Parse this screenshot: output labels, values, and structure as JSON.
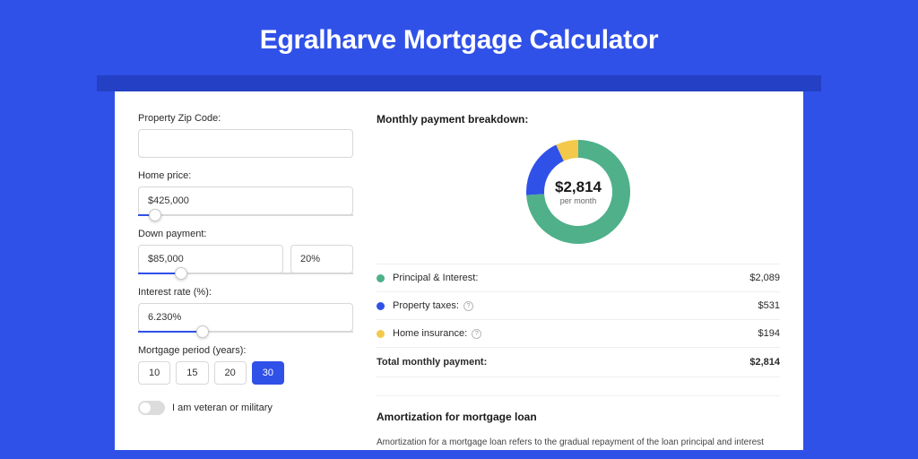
{
  "header": {
    "title": "Egralharve Mortgage Calculator"
  },
  "form": {
    "zip_label": "Property Zip Code:",
    "zip_value": "",
    "home_price_label": "Home price:",
    "home_price_value": "$425,000",
    "home_price_slider_pct": 8,
    "down_payment_label": "Down payment:",
    "down_payment_value": "$85,000",
    "down_payment_pct_value": "20%",
    "down_payment_slider_pct": 20,
    "interest_label": "Interest rate (%):",
    "interest_value": "6.230%",
    "interest_slider_pct": 30,
    "period_label": "Mortgage period (years):",
    "period_options": [
      "10",
      "15",
      "20",
      "30"
    ],
    "period_selected": "30",
    "veteran_label": "I am veteran or military",
    "veteran_checked": false
  },
  "breakdown": {
    "title": "Monthly payment breakdown:",
    "center_amount": "$2,814",
    "center_sub": "per month",
    "items": [
      {
        "label": "Principal & Interest:",
        "value": "$2,089",
        "color": "#4fb08a",
        "pct": 74,
        "help": false
      },
      {
        "label": "Property taxes:",
        "value": "$531",
        "color": "#3051e8",
        "pct": 19,
        "help": true
      },
      {
        "label": "Home insurance:",
        "value": "$194",
        "color": "#f3c94b",
        "pct": 7,
        "help": true
      }
    ],
    "total_label": "Total monthly payment:",
    "total_value": "$2,814"
  },
  "amortization": {
    "title": "Amortization for mortgage loan",
    "text": "Amortization for a mortgage loan refers to the gradual repayment of the loan principal and interest over a specified"
  },
  "chart_data": {
    "type": "pie",
    "title": "Monthly payment breakdown",
    "series": [
      {
        "name": "Principal & Interest",
        "value": 2089,
        "color": "#4fb08a"
      },
      {
        "name": "Property taxes",
        "value": 531,
        "color": "#3051e8"
      },
      {
        "name": "Home insurance",
        "value": 194,
        "color": "#f3c94b"
      }
    ],
    "total": 2814,
    "unit": "USD per month"
  }
}
